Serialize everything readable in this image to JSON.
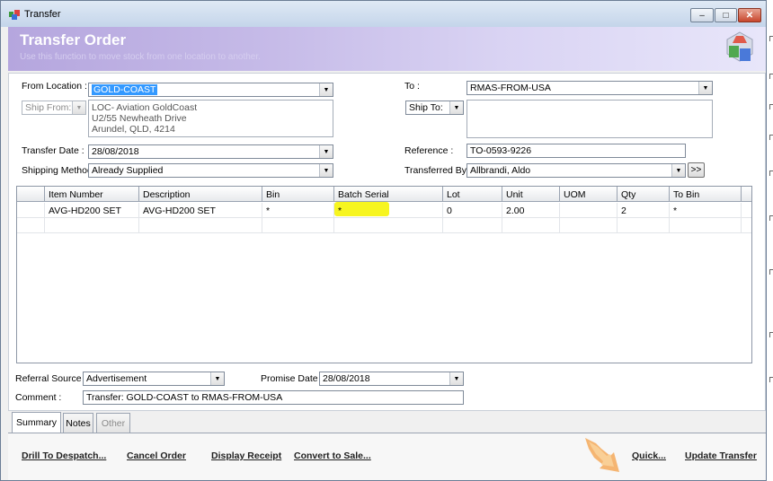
{
  "window": {
    "title": "Transfer",
    "minimize_label": "‒",
    "maximize_label": "□",
    "close_label": "✕"
  },
  "banner": {
    "title": "Transfer Order",
    "subtitle": "Use this function to move stock from one location to another."
  },
  "form": {
    "from_location_label": "From Location :",
    "from_location_value": "GOLD-COAST",
    "ship_from_label": "Ship From:",
    "ship_from_address": [
      "LOC- Aviation GoldCoast",
      "U2/55 Newheath Drive",
      "Arundel, QLD, 4214"
    ],
    "transfer_date_label": "Transfer Date :",
    "transfer_date_value": "28/08/2018",
    "shipping_method_label": "Shipping Method :",
    "shipping_method_value": "Already Supplied",
    "to_label": "To :",
    "to_value": "RMAS-FROM-USA",
    "ship_to_label": "Ship To:",
    "ship_to_address": "",
    "reference_label": "Reference :",
    "reference_value": "TO-0593-9226",
    "transferred_by_label": "Transferred By :",
    "transferred_by_value": "Allbrandi, Aldo",
    "transferred_by_button": ">>"
  },
  "grid": {
    "columns": [
      "",
      "Item Number",
      "Description",
      "Bin",
      "Batch Serial",
      "Lot",
      "Unit",
      "UOM",
      "Qty",
      "To Bin"
    ],
    "rows": [
      [
        "",
        "AVG-HD200 SET",
        "AVG-HD200 SET",
        "*",
        "*",
        "0",
        "2.00",
        "",
        "2",
        "*"
      ]
    ]
  },
  "bottom": {
    "referral_source_label": "Referral Source :",
    "referral_source_value": "Advertisement",
    "promise_date_label": "Promise Date :",
    "promise_date_value": "28/08/2018",
    "comment_label": "Comment :",
    "comment_value": "Transfer: GOLD-COAST to RMAS-FROM-USA"
  },
  "tabs": [
    "Summary",
    "Notes",
    "Other"
  ],
  "footer": {
    "links": [
      "Drill To Despatch...",
      "Cancel Order",
      "Display Receipt",
      "Convert to Sale...",
      "Quick...",
      "Update Transfer"
    ]
  },
  "colors": {
    "banner_start": "#b5a6de",
    "banner_end": "#e8e6fa",
    "selection": "#3399ff",
    "highlight": "#f7f520",
    "quick_arrow": "#f4a95a"
  }
}
